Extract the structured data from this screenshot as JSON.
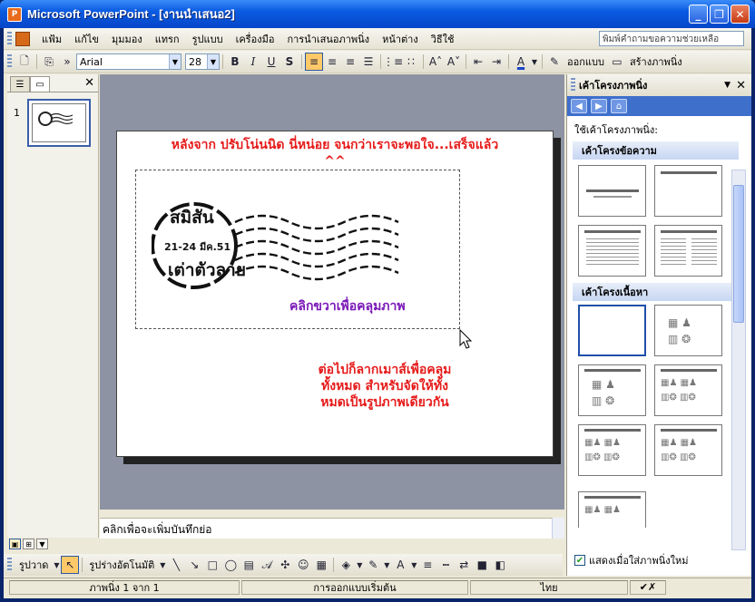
{
  "titlebar": {
    "title": "Microsoft PowerPoint - [งานนำเสนอ2]"
  },
  "menu": {
    "items": [
      "แฟ้ม",
      "แก้ไข",
      "มุมมอง",
      "แทรก",
      "รูปแบบ",
      "เครื่องมือ",
      "การนำเสนอภาพนิ่ง",
      "หน้าต่าง",
      "วิธีใช้"
    ],
    "help_placeholder": "พิมพ์คำถามขอความช่วยเหลือ"
  },
  "formatting": {
    "font": "Arial",
    "size": "28",
    "design_label": "ออกแบบ",
    "new_slide_label": "สร้างภาพนิ่ง"
  },
  "outline": {
    "slide_number": "1"
  },
  "slide": {
    "note1_line1": "หลังจาก ปรับโน่นนิด นี่หน่อย จนกว่าเราจะพอใจ...เสร็จแล้ว",
    "note1_line2": "^^",
    "stamp_top": "สมิสัน",
    "stamp_date": "21-24 มีค.51",
    "stamp_bottom": "เต่าตัวลาย",
    "note2": "คลิกขวาเพื่อคลุมภาพ",
    "note3_line1": "ต่อไปก็ลากเมาส์เพื่อคลุม",
    "note3_line2": "ทั้งหมด สำหรับจัดให้ทั้ง",
    "note3_line3": "หมดเป็นรูปภาพเดียวกัน"
  },
  "notes": {
    "placeholder": "คลิกเพื่อจะเพิ่มบันทึกย่อ"
  },
  "drawing": {
    "draw_label": "รูปวาด",
    "autoshapes_label": "รูปร่างอัตโนมัติ"
  },
  "status": {
    "slide_info": "ภาพนิ่ง 1 จาก 1",
    "design": "การออกแบบเริ่มต้น",
    "language": "ไทย"
  },
  "taskpane": {
    "title": "เค้าโครงภาพนิ่ง",
    "apply_label": "ใช้เค้าโครงภาพนิ่ง:",
    "section_text": "เค้าโครงข้อความ",
    "section_content": "เค้าโครงเนื้อหา",
    "show_when_label": "แสดงเมื่อใส่ภาพนิ่งใหม่"
  },
  "colors": {
    "accent": "#0a5be2",
    "red_text": "#e61b1b",
    "purple_text": "#7a18b8"
  }
}
